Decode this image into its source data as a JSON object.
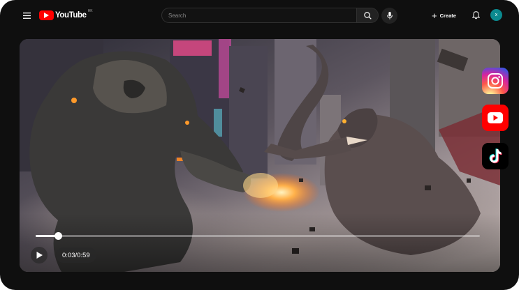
{
  "header": {
    "menu_icon": "hamburger-menu-icon",
    "logo_text": "YouTube",
    "logo_region": "HK",
    "search_placeholder": "Search",
    "search_icon": "search-icon",
    "mic_icon": "microphone-icon",
    "create_label": "Create",
    "bell_icon": "bell-icon",
    "avatar_initial": "x"
  },
  "colors": {
    "youtube_red": "#ff0000",
    "background": "#0f0f0f",
    "avatar": "#0b8a8f"
  },
  "social_icons": [
    {
      "name": "instagram-icon"
    },
    {
      "name": "youtube-icon"
    },
    {
      "name": "tiktok-icon"
    }
  ],
  "player": {
    "current_time": "0:03",
    "duration": "0:59",
    "time_display": "0:03/0:59",
    "progress": 0.05
  }
}
